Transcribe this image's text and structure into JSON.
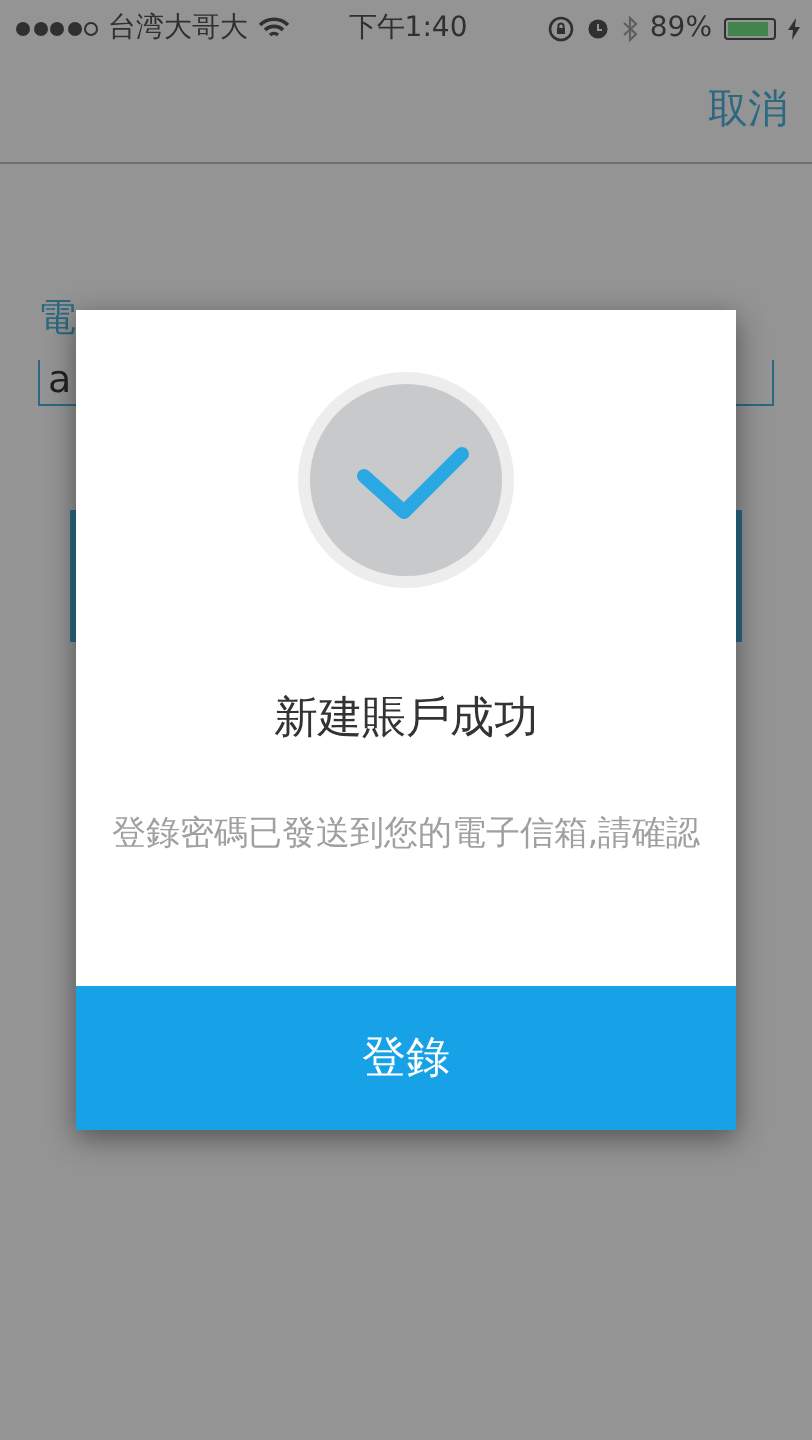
{
  "status_bar": {
    "signal_dots": [
      {
        "filled": true
      },
      {
        "filled": true
      },
      {
        "filled": true
      },
      {
        "filled": true
      },
      {
        "filled": false
      }
    ],
    "carrier": "台湾大哥大",
    "time": "下午1:40",
    "battery_percent": "89%",
    "battery": {
      "level": 0.89
    }
  },
  "nav_bar": {
    "cancel": "取消"
  },
  "form": {
    "email_label": "電",
    "email_value": "a"
  },
  "dialog": {
    "title": "新建賬戶成功",
    "message": "登錄密碼已發送到您的電子信箱,請確認",
    "button": "登錄"
  }
}
